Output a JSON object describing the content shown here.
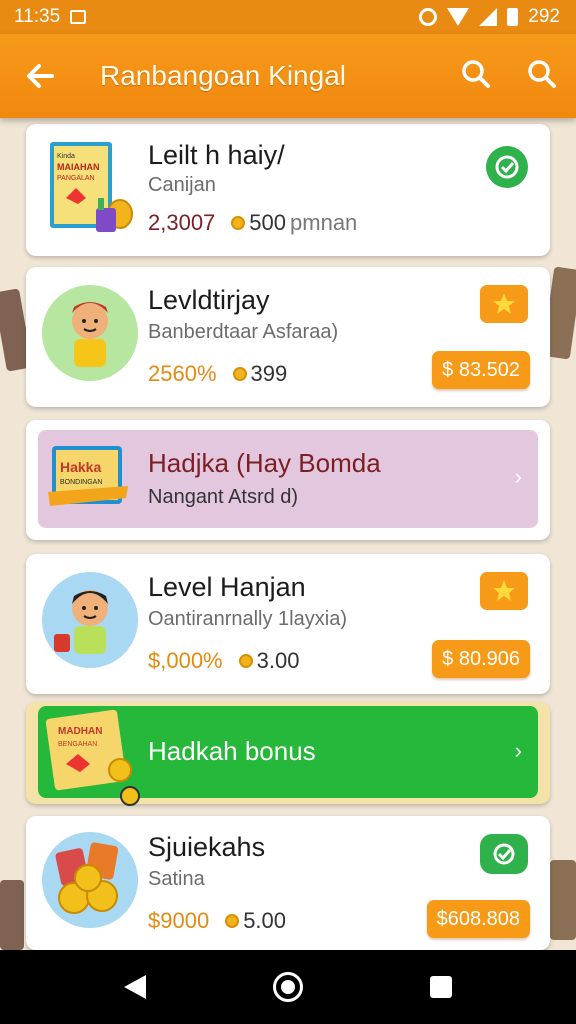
{
  "status_bar": {
    "time": "11:35",
    "battery": "292"
  },
  "app_bar": {
    "title": "Ranbangoan Kingal"
  },
  "items": [
    {
      "title": "Leilt h haiy/",
      "subtitle": "Canijan",
      "stat_a": "2,3007",
      "stat_b": "500",
      "stat_c": "pmnan",
      "stat_a_color": "#7a1f24"
    },
    {
      "title": "Levldtirjay",
      "subtitle": "Banberdtaar Asfaraa)",
      "stat_a": "2560%",
      "stat_b": "399",
      "price": "$ 83.502",
      "stat_a_color": "#e58a10"
    },
    {
      "title": "Level Hanjan",
      "subtitle": "Oantiranrnally 1layxia)",
      "stat_a": "$,000%",
      "stat_b": "3.00",
      "price": "$ 80.906",
      "stat_a_color": "#e58a10"
    },
    {
      "title": "Sjuiekahs",
      "subtitle": "Satina",
      "stat_a": "$9000",
      "stat_b": "5.00",
      "price": "$608.808",
      "stat_a_color": "#e58a10"
    }
  ],
  "banner_1": {
    "title": "Hadjka (Hay Bomda",
    "subtitle": "Nangant Atsrd d)"
  },
  "banner_2": {
    "title": "Hadkah bonus"
  },
  "thumb_texts": {
    "book_1_top": "Kinda",
    "book_1_main": "MAIAHAN",
    "book_1_sub": "PANGALAN",
    "banner_book_main": "Hakka",
    "banner_book_sub": "BONDINGAN",
    "bonus_book_main": "MADHAN",
    "bonus_book_sub": "BENGAHAN"
  },
  "colors": {
    "accent": "#f69a18",
    "appbar": "#f1880f",
    "banner_purple": "#e3c7df",
    "banner_green": "#26b83a",
    "title_dark_red": "#7a1f24"
  },
  "icons": {
    "back": "arrow-left-icon",
    "search": "search-icon",
    "star": "star-icon",
    "badge": "check-badge-icon",
    "chevron": "chevron-right-icon"
  }
}
